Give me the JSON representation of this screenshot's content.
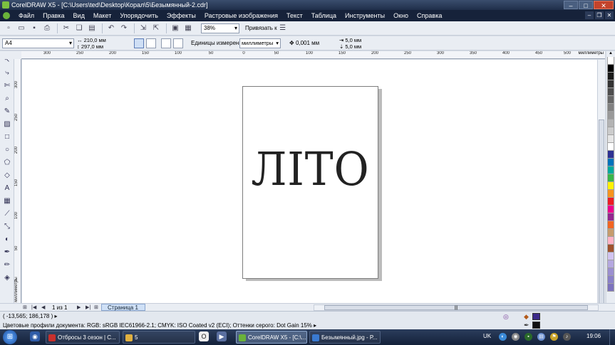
{
  "window": {
    "title": "CorelDRAW X5 - [C:\\Users\\ted\\Desktop\\Корал\\5\\Безымянный-2.cdr]",
    "controls": [
      "–",
      "□",
      "✕"
    ]
  },
  "menu": [
    "Файл",
    "Правка",
    "Вид",
    "Макет",
    "Упорядочить",
    "Эффекты",
    "Растровые изображения",
    "Текст",
    "Таблица",
    "Инструменты",
    "Окно",
    "Справка"
  ],
  "toolbar": {
    "zoom": "38%",
    "snap_label": "Привязать к"
  },
  "property_bar": {
    "page_size": "A4",
    "width": "210,0 мм",
    "height": "297,0 мм",
    "units_label": "Единицы измерения:",
    "units": "миллиметры",
    "nudge": "0,001 мм",
    "dup_x": "5,0 мм",
    "dup_y": "5,0 мм"
  },
  "rulers": {
    "h_ticks": [
      "300",
      "250",
      "200",
      "150",
      "100",
      "50",
      "0",
      "50",
      "100",
      "150",
      "200",
      "250",
      "300",
      "350",
      "400",
      "450",
      "500"
    ],
    "h_units": "миллиметры",
    "v_ticks": [
      "300",
      "250",
      "200",
      "150",
      "100",
      "50",
      "0"
    ],
    "v_units": "миллиметры"
  },
  "document": {
    "artwork_text": "ЛІТО"
  },
  "pagenav": {
    "count": "1 из 1",
    "tab": "Страница 1"
  },
  "status": {
    "coords": "( -13,565; 186,178 )",
    "profile": "Цветовые профили документа: RGB: sRGB IEC61966-2.1; CMYK: ISO Coated v2 (ECI); Оттенки серого: Dot Gain 15%",
    "fill_color": "#3c2a8a",
    "outline_color": "#111111"
  },
  "palette": [
    "#ffffff",
    "#000000",
    "#1a1a1a",
    "#333333",
    "#4d4d4d",
    "#666666",
    "#808080",
    "#999999",
    "#b3b3b3",
    "#cccccc",
    "#e6e6e6",
    "#ffffff",
    "#2e3192",
    "#0072bc",
    "#00a99d",
    "#39b54a",
    "#fff200",
    "#f7941d",
    "#ed1c24",
    "#ec008c",
    "#92278f",
    "#f26522",
    "#c69c6d",
    "#ffb3c6",
    "#a0522d",
    "#d2c4f0",
    "#b5a8e0",
    "#9b8fd0",
    "#8a80c8",
    "#7c72bd"
  ],
  "taskbar": {
    "tasks": [
      {
        "label": "Отбросы 3 сезон | С...",
        "color": "#c8302c"
      },
      {
        "label": "5",
        "color": "#e0b040"
      },
      {
        "label": "CorelDRAW X5 - [C:\\...",
        "color": "#6ab23a"
      },
      {
        "label": "Безымянный.jpg - Р...",
        "color": "#3a7ad0"
      }
    ],
    "lang": "UK",
    "clock": "19:06"
  }
}
